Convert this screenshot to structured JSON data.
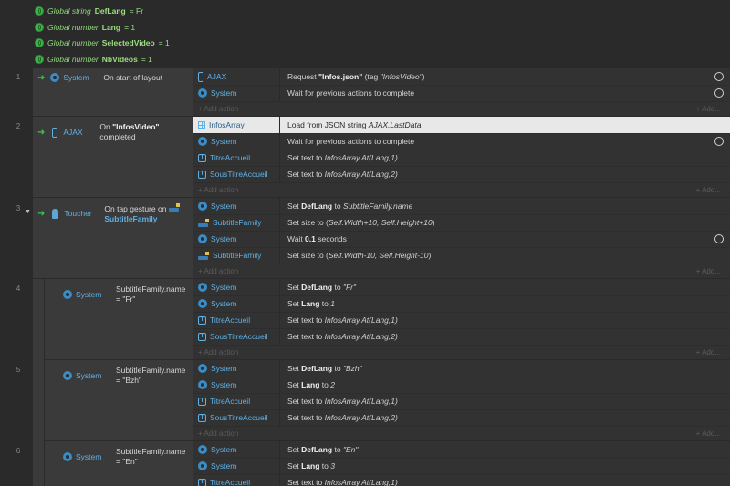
{
  "globals": [
    {
      "type": "Global string",
      "name": "DefLang",
      "value": "= Fr"
    },
    {
      "type": "Global number",
      "name": "Lang",
      "value": "= 1"
    },
    {
      "type": "Global number",
      "name": "SelectedVideo",
      "value": "= 1"
    },
    {
      "type": "Global number",
      "name": "NbVideos",
      "value": "= 1"
    }
  ],
  "events": [
    {
      "num": "1",
      "cond_obj": "System",
      "cond_text": "On start of layout",
      "actions": [
        {
          "obj": "AJAX",
          "pre": "Request ",
          "bold": "\"Infos.json\"",
          "post": " (tag ",
          "italic": "\"InfosVideo\"",
          "end": ")"
        },
        {
          "obj": "System",
          "text": "Wait for previous actions to complete"
        }
      ]
    },
    {
      "num": "2",
      "cond_obj": "AJAX",
      "cond_text1": "On ",
      "cond_bold": "\"InfosVideo\"",
      "cond_text2": "completed",
      "actions": [
        {
          "obj": "InfosArray",
          "pre": "Load from JSON string ",
          "italic": "AJAX.LastData"
        },
        {
          "obj": "System",
          "text": "Wait for previous actions to complete"
        },
        {
          "obj": "TitreAccueil",
          "pre": "Set text to ",
          "italic": "InfosArray.At(Lang,1)"
        },
        {
          "obj": "SousTitreAccueil",
          "pre": "Set text to ",
          "italic": "InfosArray.At(Lang,2)"
        }
      ]
    },
    {
      "num": "3",
      "cond_obj": "Toucher",
      "cond_text": "On tap gesture on",
      "cond_target": "SubtitleFamily",
      "actions": [
        {
          "obj": "System",
          "pre": "Set ",
          "bold": "DefLang",
          "post": " to ",
          "italic": "SubtitleFamily.name"
        },
        {
          "obj": "SubtitleFamily",
          "pre": "Set size to (",
          "italic": "Self.Width+10, Self.Height+10",
          "end": ")"
        },
        {
          "obj": "System",
          "pre": "Wait ",
          "bold": "0.1",
          "post": " seconds"
        },
        {
          "obj": "SubtitleFamily",
          "pre": "Set size to (",
          "italic": "Self.Width-10, Self.Height-10",
          "end": ")"
        }
      ]
    },
    {
      "num": "4",
      "cond_obj": "System",
      "cond_line1": "SubtitleFamily.name",
      "cond_line2": "= \"Fr\"",
      "actions": [
        {
          "obj": "System",
          "pre": "Set ",
          "bold": "DefLang",
          "post": " to ",
          "italic": "\"Fr\""
        },
        {
          "obj": "System",
          "pre": "Set ",
          "bold": "Lang",
          "post": " to ",
          "italic": "1"
        },
        {
          "obj": "TitreAccueil",
          "pre": "Set text to ",
          "italic": "InfosArray.At(Lang,1)"
        },
        {
          "obj": "SousTitreAccueil",
          "pre": "Set text to ",
          "italic": "InfosArray.At(Lang,2)"
        }
      ]
    },
    {
      "num": "5",
      "cond_obj": "System",
      "cond_line1": "SubtitleFamily.name",
      "cond_line2": "= \"Bzh\"",
      "actions": [
        {
          "obj": "System",
          "pre": "Set ",
          "bold": "DefLang",
          "post": " to ",
          "italic": "\"Bzh\""
        },
        {
          "obj": "System",
          "pre": "Set ",
          "bold": "Lang",
          "post": " to ",
          "italic": "2"
        },
        {
          "obj": "TitreAccueil",
          "pre": "Set text to ",
          "italic": "InfosArray.At(Lang,1)"
        },
        {
          "obj": "SousTitreAccueil",
          "pre": "Set text to ",
          "italic": "InfosArray.At(Lang,2)"
        }
      ]
    },
    {
      "num": "6",
      "cond_obj": "System",
      "cond_line1": "SubtitleFamily.name",
      "cond_line2": "= \"En\"",
      "actions": [
        {
          "obj": "System",
          "pre": "Set ",
          "bold": "DefLang",
          "post": " to ",
          "italic": "\"En\""
        },
        {
          "obj": "System",
          "pre": "Set ",
          "bold": "Lang",
          "post": " to ",
          "italic": "3"
        },
        {
          "obj": "TitreAccueil",
          "pre": "Set text to ",
          "italic": "InfosArray.At(Lang,1)"
        }
      ]
    }
  ],
  "add_action": "+ Add action",
  "add_more": "+ Add..."
}
